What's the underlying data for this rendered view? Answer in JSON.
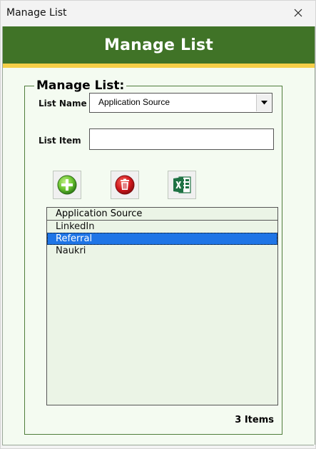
{
  "window": {
    "title": "Manage List"
  },
  "banner": {
    "title": "Manage List"
  },
  "frame": {
    "caption": "Manage List:"
  },
  "form": {
    "list_name_label": "List Name",
    "list_name_value": "Application Source",
    "list_item_label": "List Item",
    "list_item_value": ""
  },
  "toolbar": {
    "icons": [
      "add-icon",
      "delete-icon",
      "excel-icon"
    ],
    "colors": {
      "add": "#46a62c",
      "delete": "#c8141b",
      "excel": "#1f7244"
    }
  },
  "list": {
    "header": "Application Source",
    "items": [
      "LinkedIn",
      "Referral",
      "Naukri"
    ],
    "selected": "Referral"
  },
  "status": {
    "count_text": "3 Items"
  },
  "colors": {
    "banner": "#407327",
    "stripe": "#f5cf48",
    "selection": "#1f75e6",
    "panel": "#f4fbf1",
    "list_bg": "#ebf4e6"
  }
}
